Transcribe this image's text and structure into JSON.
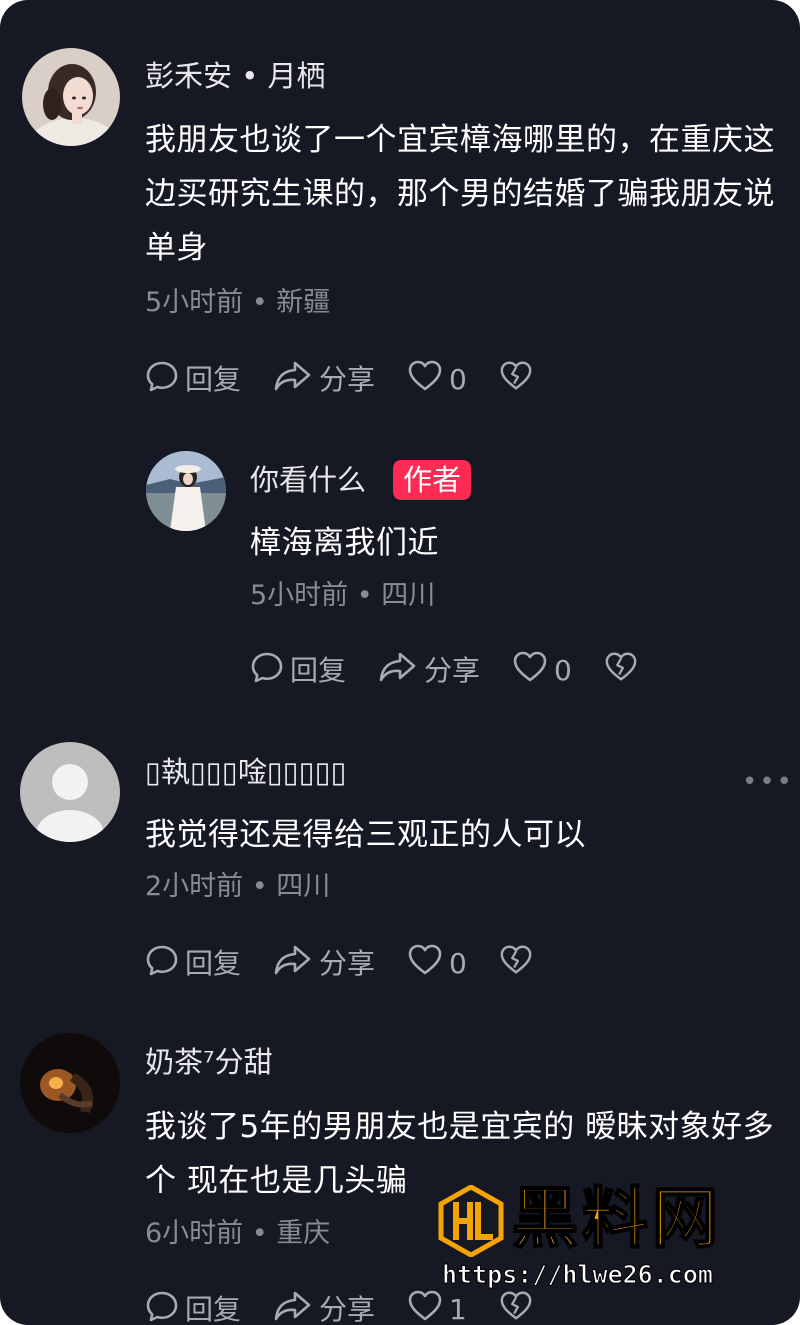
{
  "comments": [
    {
      "nickname": "彭禾安 • 月栖",
      "text": "我朋友也谈了一个宜宾樟海哪里的，在重庆这边买研究生课的，那个男的结婚了骗我朋友说单身",
      "meta": "5小时前 • 新疆",
      "actions": {
        "reply": "回复",
        "share": "分享",
        "likes": "0"
      }
    },
    {
      "nickname": "你看什么",
      "badge": "作者",
      "text": "樟海离我们近",
      "meta": "5小时前 • 四川",
      "actions": {
        "reply": "回复",
        "share": "分享",
        "likes": "0"
      }
    },
    {
      "nickname": "▯執▯▯▯唫▯▯▯▯▯",
      "text": "我觉得还是得给三观正的人可以",
      "meta": "2小时前 • 四川",
      "more": "•••",
      "actions": {
        "reply": "回复",
        "share": "分享",
        "likes": "0"
      }
    },
    {
      "nickname": "奶茶⁷分甜",
      "text": "我谈了5年的男朋友也是宜宾的 暧昧对象好多个 现在也是几头骗",
      "meta": "6小时前 • 重庆",
      "actions": {
        "reply": "回复",
        "share": "分享",
        "likes": "1"
      }
    }
  ],
  "icons": {
    "reply": "comment-bubble-icon",
    "share": "share-arrow-icon",
    "like": "heart-icon",
    "dislike": "broken-heart-icon",
    "more": "more-dots-icon"
  },
  "watermark": {
    "title": "黑料网",
    "url": "https://hlwe26.com",
    "logo": "HL"
  },
  "colors": {
    "background": "#161823",
    "badge": "#fe2c55",
    "watermark": "#f5a300"
  }
}
